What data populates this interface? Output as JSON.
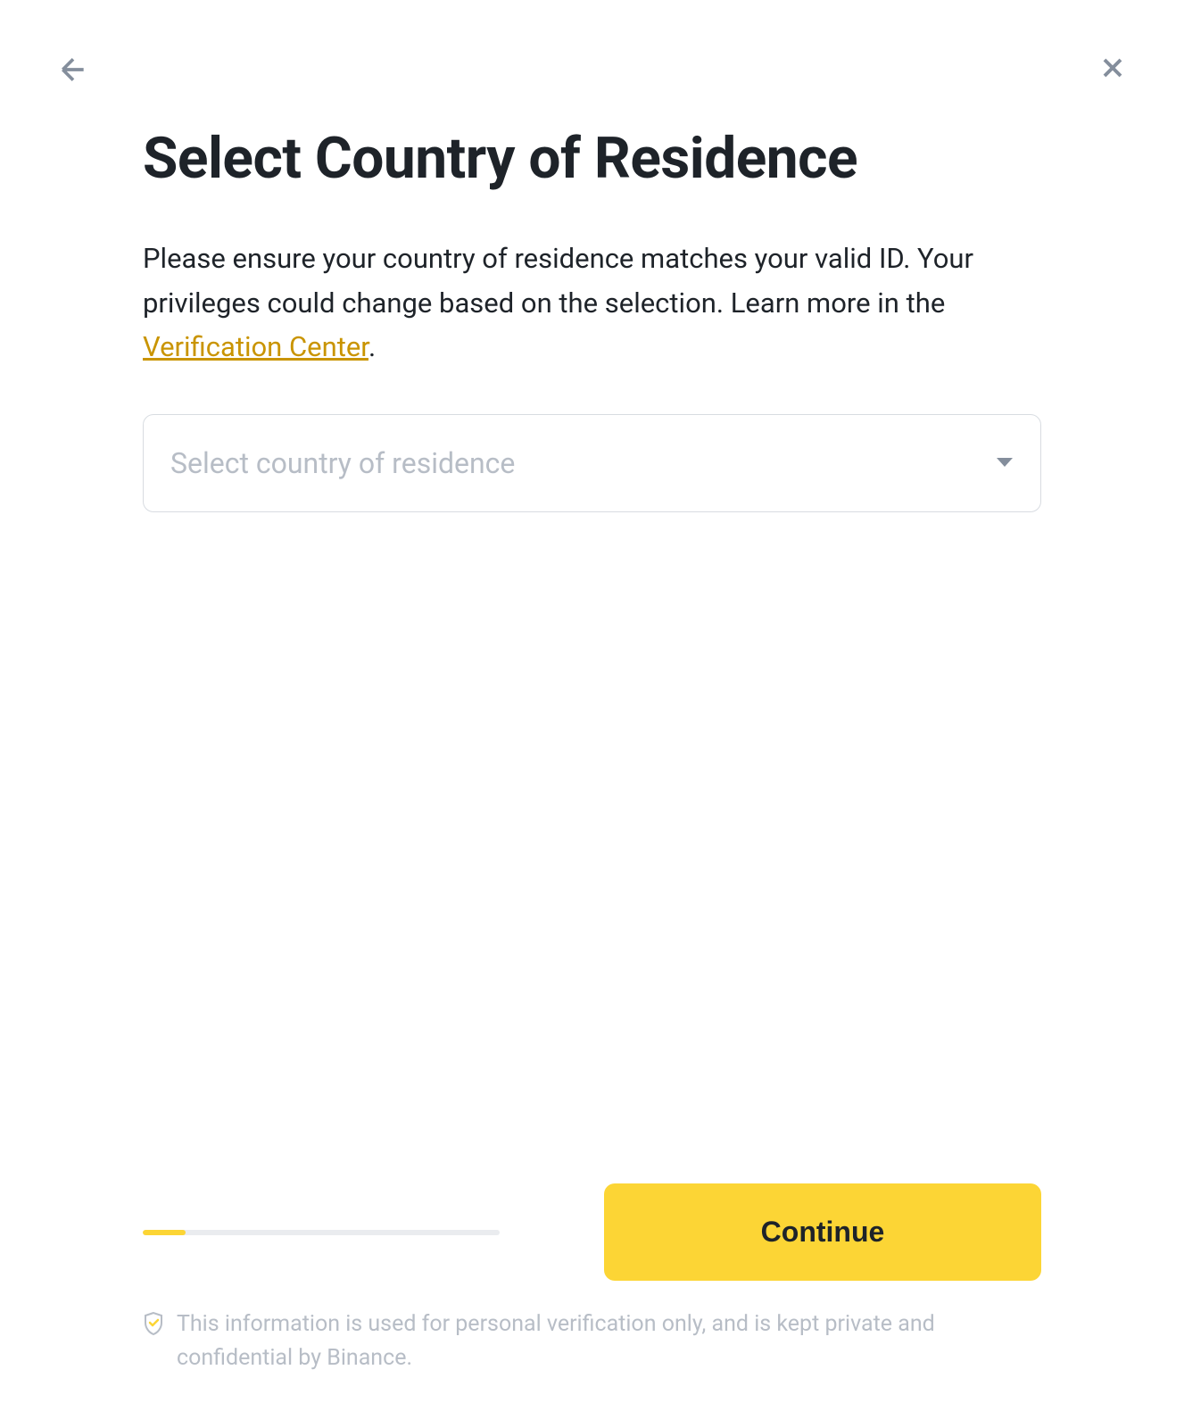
{
  "title": "Select Country of Residence",
  "description": {
    "text_before": "Please ensure your country of residence matches your valid ID. Your privileges could change based on the selection. Learn more in the ",
    "link_text": "Verification Center",
    "text_after": "."
  },
  "select": {
    "placeholder": "Select country of residence"
  },
  "progress": {
    "percent": 12
  },
  "continue_button": {
    "label": "Continue"
  },
  "privacy": {
    "text": "This information is used for personal verification only, and is kept private and confidential by Binance."
  }
}
